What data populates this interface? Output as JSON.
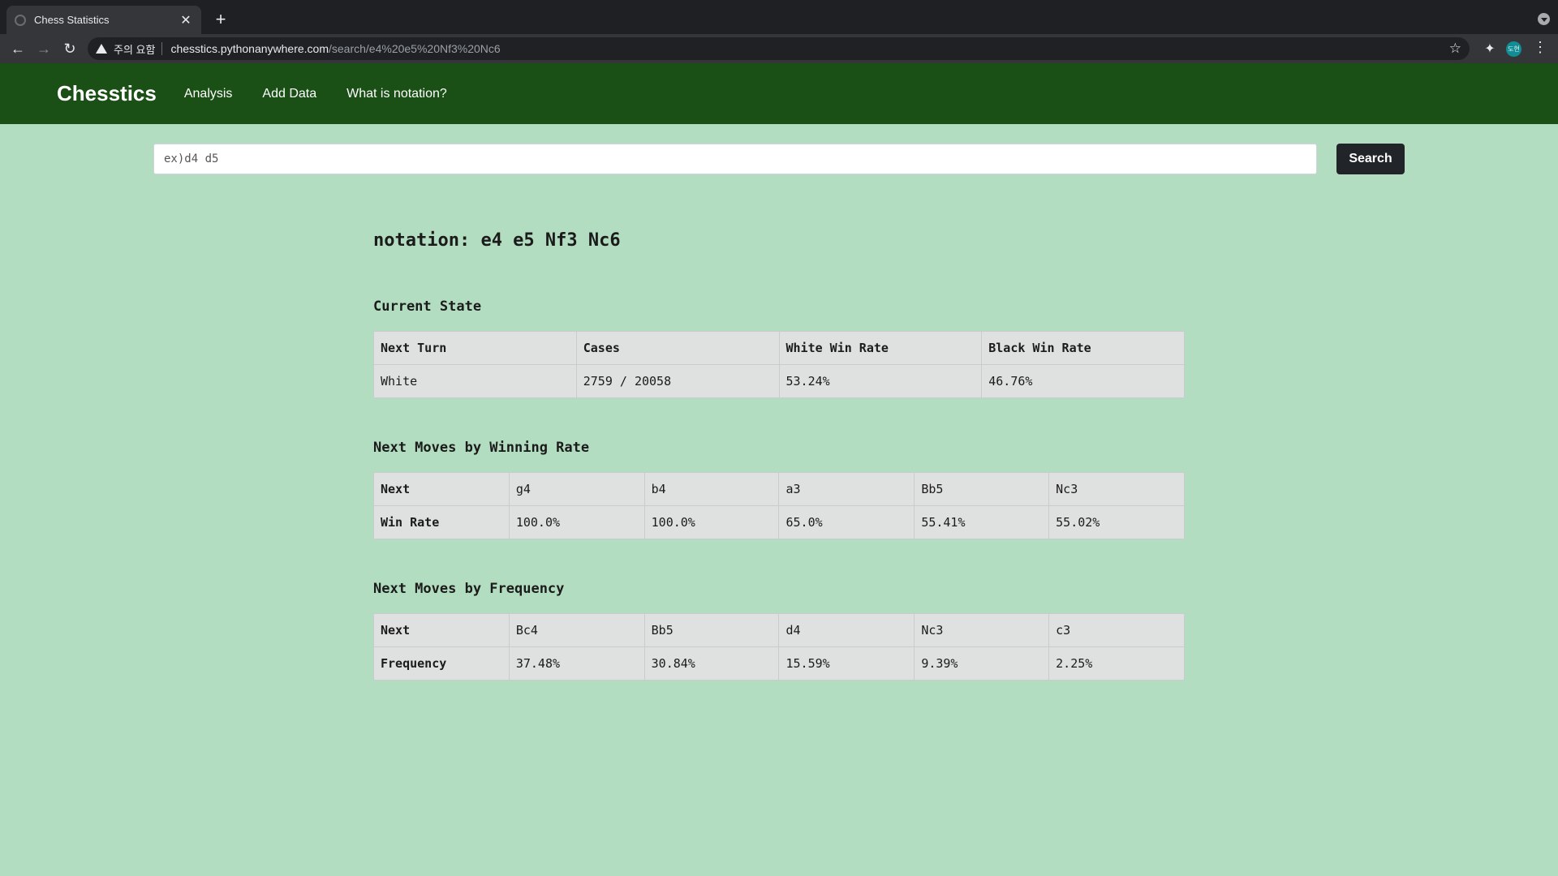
{
  "browser": {
    "tab_title": "Chess Statistics",
    "security_label": "주의 요함",
    "url_host": "chesstics.pythonanywhere.com",
    "url_path": "/search/e4%20e5%20Nf3%20Nc6",
    "avatar_text": "도현"
  },
  "site": {
    "brand": "Chesstics",
    "nav": [
      "Analysis",
      "Add Data",
      "What is notation?"
    ]
  },
  "search": {
    "placeholder": "ex)d4 d5",
    "button_label": "Search"
  },
  "notation_title": "notation: e4 e5 Nf3 Nc6",
  "current_state": {
    "title": "Current State",
    "headers": [
      "Next Turn",
      "Cases",
      "White Win Rate",
      "Black Win Rate"
    ],
    "values": [
      "White",
      "2759 / 20058",
      "53.24%",
      "46.76%"
    ]
  },
  "winning_rate": {
    "title": "Next Moves by Winning Rate",
    "row1_label": "Next",
    "moves": [
      "g4",
      "b4",
      "a3",
      "Bb5",
      "Nc3"
    ],
    "row2_label": "Win Rate",
    "rates": [
      "100.0%",
      "100.0%",
      "65.0%",
      "55.41%",
      "55.02%"
    ]
  },
  "frequency": {
    "title": "Next Moves by Frequency",
    "row1_label": "Next",
    "moves": [
      "Bc4",
      "Bb5",
      "d4",
      "Nc3",
      "c3"
    ],
    "row2_label": "Frequency",
    "freqs": [
      "37.48%",
      "30.84%",
      "15.59%",
      "9.39%",
      "2.25%"
    ]
  }
}
